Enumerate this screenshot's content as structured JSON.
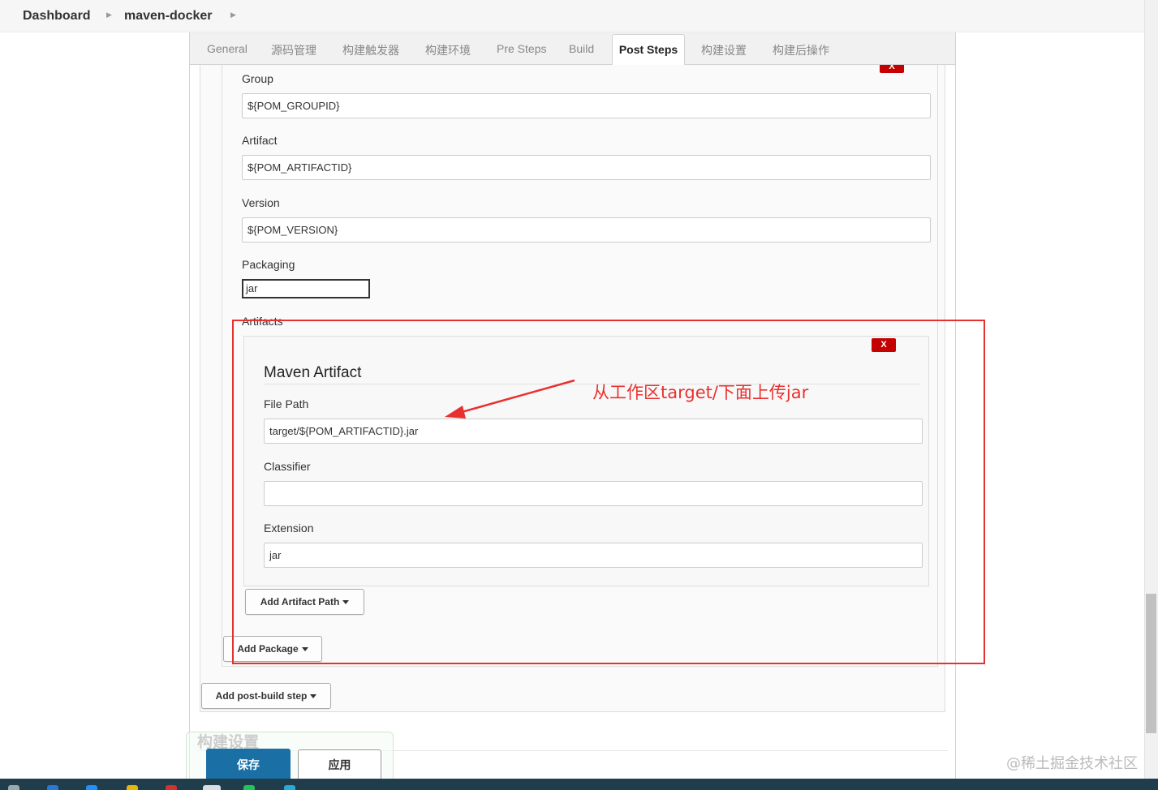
{
  "breadcrumb": {
    "items": [
      "Dashboard",
      "maven-docker"
    ]
  },
  "tabs": [
    "General",
    "源码管理",
    "构建触发器",
    "构建环境",
    "Pre Steps",
    "Build",
    "Post Steps",
    "构建设置",
    "构建后操作"
  ],
  "active_tab": "Post Steps",
  "package": {
    "group_label": "Group",
    "group_value": "${POM_GROUPID}",
    "artifact_label": "Artifact",
    "artifact_value": "${POM_ARTIFACTID}",
    "version_label": "Version",
    "version_value": "${POM_VERSION}",
    "packaging_label": "Packaging",
    "packaging_value": "jar",
    "artifacts_label": "Artifacts",
    "delete_label": "X"
  },
  "maven_artifact": {
    "title": "Maven Artifact",
    "delete_label": "X",
    "file_path_label": "File Path",
    "file_path_value": "target/${POM_ARTIFACTID}.jar",
    "classifier_label": "Classifier",
    "classifier_value": "",
    "extension_label": "Extension",
    "extension_value": "jar"
  },
  "buttons": {
    "add_artifact_path": "Add Artifact Path",
    "add_package": "Add Package",
    "add_post_build_step": "Add post-build step",
    "save": "保存",
    "apply": "应用"
  },
  "section_heading": "构建设置",
  "annotation": {
    "text": "从工作区target/下面上传jar",
    "color": "#e8312f"
  },
  "watermark": "@稀土掘金技术社区",
  "colors": {
    "save": "#1a6fa5",
    "delete": "#c50000",
    "annotation": "#e8312f"
  }
}
